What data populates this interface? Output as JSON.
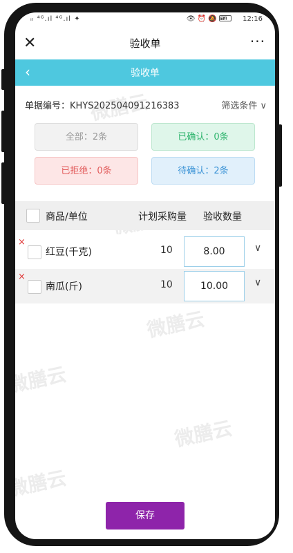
{
  "status_bar": {
    "left": "ᵢₗ ⁴ᴳ.ıl ⁴ᴳ.ıl ✦",
    "right": "👁 ⏰ 🔕",
    "battery_level": "74",
    "time": "12:16"
  },
  "titlebar": {
    "close": "✕",
    "title": "验收单",
    "more": "···"
  },
  "header": {
    "back": "‹",
    "title": "验收单"
  },
  "document": {
    "label": "单据编号：KHYS202504091216383",
    "filter": "筛选条件",
    "filter_chevron": "∨"
  },
  "stats": {
    "all": "全部：2条",
    "confirmed": "已确认：0条",
    "rejected": "已拒绝：0条",
    "pending": "待确认：2条"
  },
  "table": {
    "headers": [
      "商品/单位",
      "计划采购量",
      "验收数量"
    ],
    "rows": [
      {
        "delete": "×",
        "name": "红豆(千克)",
        "plan": "10",
        "qty": "8.00",
        "chev": "∨"
      },
      {
        "delete": "×",
        "name": "南瓜(斤)",
        "plan": "10",
        "qty": "10.00",
        "chev": "∨"
      }
    ]
  },
  "save_label": "保存",
  "watermark": "微膳云",
  "colors": {
    "header": "#4ec8df",
    "save_button": "#8e24aa",
    "delete": "#e03b3b"
  }
}
